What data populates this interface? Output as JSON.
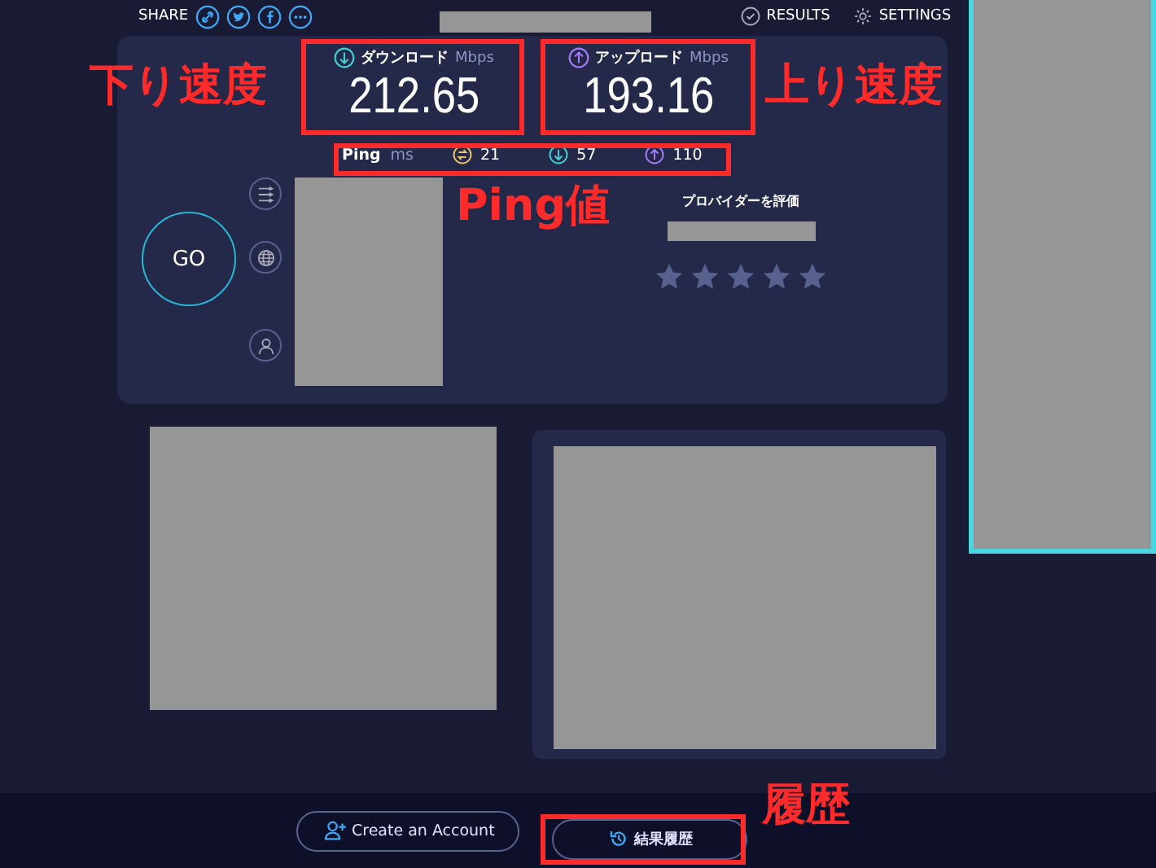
{
  "top_bar": {
    "share_label": "SHARE",
    "results_label": "RESULTS",
    "settings_label": "SETTINGS"
  },
  "download": {
    "label": "ダウンロード",
    "unit": "Mbps",
    "value": "212.65"
  },
  "upload": {
    "label": "アップロード",
    "unit": "Mbps",
    "value": "193.16"
  },
  "ping": {
    "label": "Ping",
    "unit": "ms",
    "values": [
      {
        "kind": "idle",
        "value": "21"
      },
      {
        "kind": "download",
        "value": "57"
      },
      {
        "kind": "upload",
        "value": "110"
      }
    ]
  },
  "go_button": "GO",
  "rating": {
    "title": "プロバイダーを評価"
  },
  "footer_buttons": [
    {
      "kind": "account",
      "label": "Create an Account"
    },
    {
      "kind": "history",
      "label": "結果履歴"
    }
  ],
  "annotations": [
    "下り速度",
    "上り速度",
    "Ping値",
    "履歴"
  ]
}
